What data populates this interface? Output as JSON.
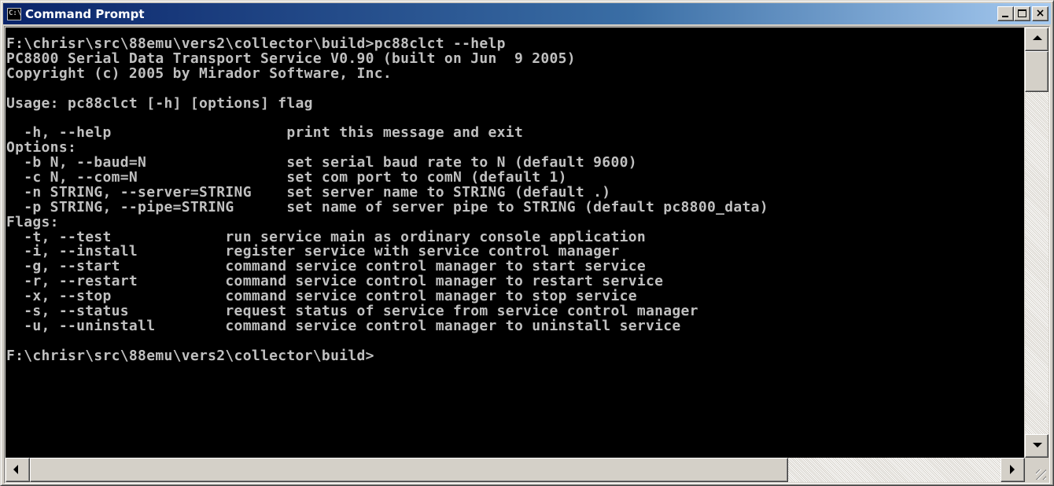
{
  "window": {
    "title": "Command Prompt",
    "icon": "cmd-icon",
    "icon_text": "C:\\"
  },
  "controls": {
    "minimize_icon": "minimize-icon",
    "maximize_icon": "maximize-icon",
    "close_label": "×"
  },
  "console": {
    "lines": [
      "F:\\chrisr\\src\\88emu\\vers2\\collector\\build>pc88clct --help",
      "PC8800 Serial Data Transport Service V0.90 (built on Jun  9 2005)",
      "Copyright (c) 2005 by Mirador Software, Inc.",
      "",
      "Usage: pc88clct [-h] [options] flag",
      "",
      "  -h, --help                    print this message and exit",
      "Options:",
      "  -b N, --baud=N                set serial baud rate to N (default 9600)",
      "  -c N, --com=N                 set com port to comN (default 1)",
      "  -n STRING, --server=STRING    set server name to STRING (default .)",
      "  -p STRING, --pipe=STRING      set name of server pipe to STRING (default pc8800_data)",
      "Flags:",
      "  -t, --test             run service main as ordinary console application",
      "  -i, --install          register service with service control manager",
      "  -g, --start            command service control manager to start service",
      "  -r, --restart          command service control manager to restart service",
      "  -x, --stop             command service control manager to stop service",
      "  -s, --status           request status of service from service control manager",
      "  -u, --uninstall        command service control manager to uninstall service",
      "",
      "F:\\chrisr\\src\\88emu\\vers2\\collector\\build>"
    ],
    "text_color": "#c0c0c0",
    "background_color": "#000000"
  },
  "colors": {
    "titlebar_start": "#0a246a",
    "titlebar_end": "#a6caf0",
    "chrome": "#d4d0c8"
  }
}
